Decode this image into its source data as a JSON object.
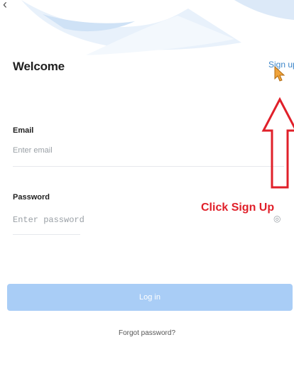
{
  "screen": {
    "title": "Welcome",
    "signup_link": "Sign up"
  },
  "form": {
    "email": {
      "label": "Email",
      "placeholder": "Enter email",
      "value": ""
    },
    "password": {
      "label": "Password",
      "placeholder": "Enter password",
      "value": ""
    },
    "login_button": "Log in",
    "forgot_password": "Forgot password?"
  },
  "annotation": {
    "text": "Click Sign Up"
  },
  "icons": {
    "back": "chevron-left-icon",
    "eye": "eye-icon",
    "cursor": "mouse-pointer-icon",
    "annotation_arrow": "up-arrow-outline"
  },
  "colors": {
    "accent": "#3d86c9",
    "login_button_disabled": "#a9cdf6",
    "annotation": "#e0202a",
    "cursor": "#f0a33a"
  }
}
